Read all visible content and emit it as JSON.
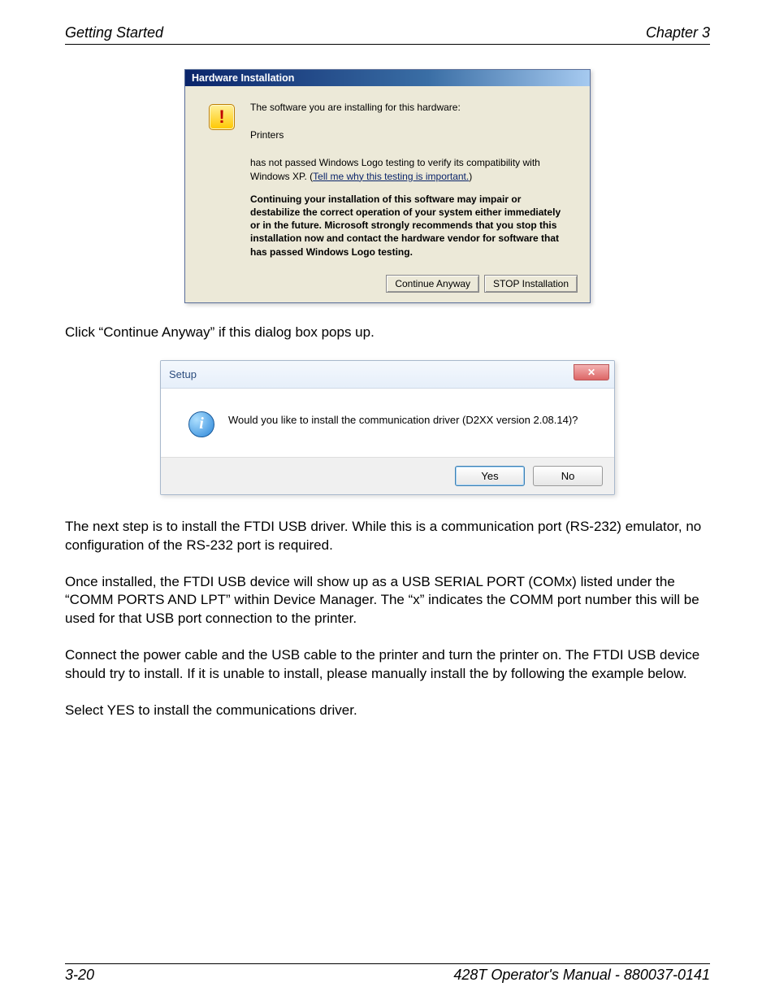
{
  "header": {
    "left": "Getting Started",
    "right": "Chapter 3"
  },
  "footer": {
    "left": "3-20",
    "right": "428T Operator's Manual - 880037-0141"
  },
  "dialog1": {
    "title": "Hardware Installation",
    "line1": "The software you are installing for this hardware:",
    "line2": "Printers",
    "line3a": "has not passed Windows Logo testing to verify its compatibility with Windows XP. (",
    "link": "Tell me why this testing is important.",
    "line3b": ")",
    "bold": "Continuing your installation of this software may impair or destabilize the correct operation of your system either immediately or in the future. Microsoft strongly recommends that you stop this installation now and contact the hardware vendor for software that has passed Windows Logo testing.",
    "btn_continue": "Continue Anyway",
    "btn_stop": "STOP Installation"
  },
  "para1": "Click “Continue Anyway” if this dialog box pops up.",
  "dialog2": {
    "title": "Setup",
    "message": "Would you like to install the communication driver (D2XX version 2.08.14)?",
    "btn_yes": "Yes",
    "btn_no": "No"
  },
  "para2": "The next step is to install the FTDI USB driver.  While this is a communication port (RS-232) emulator, no configuration of the RS-232 port is required.",
  "para3": "Once installed, the FTDI USB device will show up as a USB SERIAL PORT (COMx) listed under the “COMM PORTS AND LPT” within Device Manager.  The “x” indicates the COMM port number this will be used for that USB port connection to the printer.",
  "para4": "Connect the power cable and the USB cable to the printer and turn the printer on.  The FTDI USB device should try to install.  If it is unable to install, please manually install the by following the example below.",
  "para5": "Select YES to install the communications driver."
}
